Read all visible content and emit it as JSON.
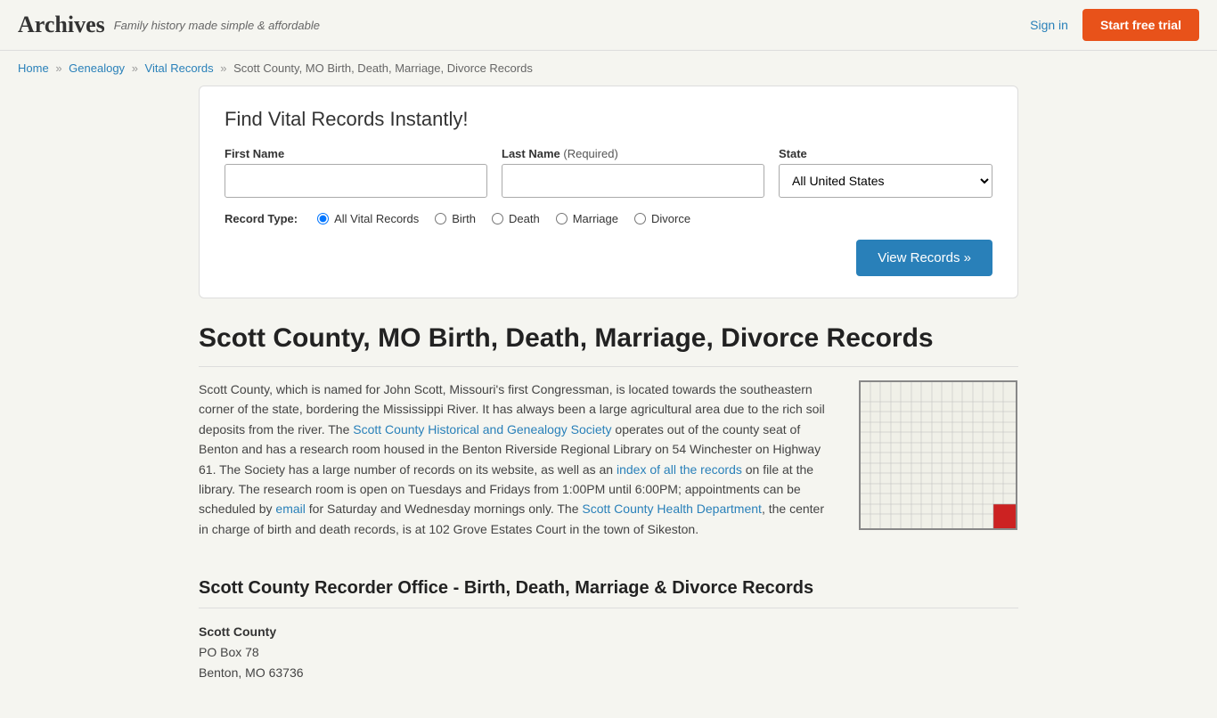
{
  "header": {
    "logo": "Archives",
    "tagline": "Family history made simple & affordable",
    "sign_in": "Sign in",
    "start_trial": "Start free trial"
  },
  "breadcrumb": {
    "home": "Home",
    "genealogy": "Genealogy",
    "vital_records": "Vital Records",
    "current": "Scott County, MO Birth, Death, Marriage, Divorce Records"
  },
  "search_form": {
    "title": "Find Vital Records Instantly!",
    "first_name_label": "First Name",
    "last_name_label": "Last Name",
    "required_note": "(Required)",
    "state_label": "State",
    "state_default": "All United States",
    "record_type_label": "Record Type:",
    "record_types": [
      "All Vital Records",
      "Birth",
      "Death",
      "Marriage",
      "Divorce"
    ],
    "view_records_btn": "View Records »"
  },
  "page": {
    "title": "Scott County, MO Birth, Death, Marriage, Divorce Records",
    "article_paragraph1": "Scott County, which is named for John Scott, Missouri's first Congressman, is located towards the southeastern corner of the state, bordering the Mississippi River. It has always been a large agricultural area due to the rich soil deposits from the river. The ",
    "society_link_text": "Scott County Historical and Genealogy Society",
    "article_paragraph1b": " operates out of the county seat of Benton and has a research room housed in the Benton Riverside Regional Library on 54 Winchester on Highway 61. The Society has a large number of records on its website, as well as an ",
    "index_link_text": "index of all the records",
    "article_paragraph1c": " on file at the library. The research room is open on Tuesdays and Fridays from 1:00PM until 6:00PM; appointments can be scheduled by ",
    "email_link_text": "email",
    "article_paragraph1d": " for Saturday and Wednesday mornings only. The ",
    "health_dept_link_text": "Scott County Health Department",
    "article_paragraph1e": ", the center in charge of birth and death records, is at 102 Grove Estates Court in the town of Sikeston.",
    "recorder_section_title": "Scott County Recorder Office - Birth, Death, Marriage & Divorce Records",
    "office_name": "Scott County",
    "office_address_line1": "PO Box 78",
    "office_address_line2": "Benton, MO 63736"
  }
}
